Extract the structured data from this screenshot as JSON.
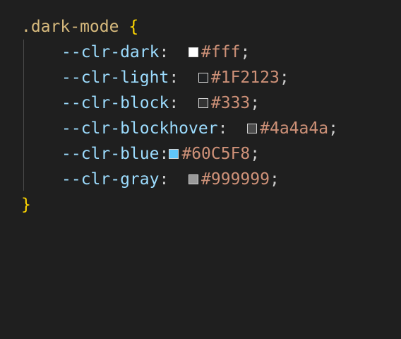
{
  "code": {
    "selector": ".dark-mode",
    "open_brace": "{",
    "close_brace": "}",
    "declarations": [
      {
        "property": "--clr-dark",
        "colon": ": ",
        "value": "#fff",
        "semicolon": ";",
        "swatch_color": "#ffffff"
      },
      {
        "property": "--clr-light",
        "colon": ": ",
        "value": "#1F2123",
        "semicolon": ";",
        "swatch_color": "#1F2123"
      },
      {
        "property": "--clr-block",
        "colon": ": ",
        "value": "#333",
        "semicolon": ";",
        "swatch_color": "#333333"
      },
      {
        "property": "--clr-blockhover",
        "colon": ": ",
        "value": "#4a4a4a",
        "semicolon": ";",
        "swatch_color": "#4a4a4a"
      },
      {
        "property": "--clr-blue",
        "colon": ":",
        "value": "#60C5F8",
        "semicolon": ";",
        "swatch_color": "#60C5F8"
      },
      {
        "property": "--clr-gray",
        "colon": ": ",
        "value": "#999999",
        "semicolon": ";",
        "swatch_color": "#999999"
      }
    ]
  },
  "colors": {
    "background": "#1f1f1f",
    "selector": "#d7ba7d",
    "brace": "#ffd700",
    "property": "#9cdcfe",
    "value": "#ce9178"
  }
}
